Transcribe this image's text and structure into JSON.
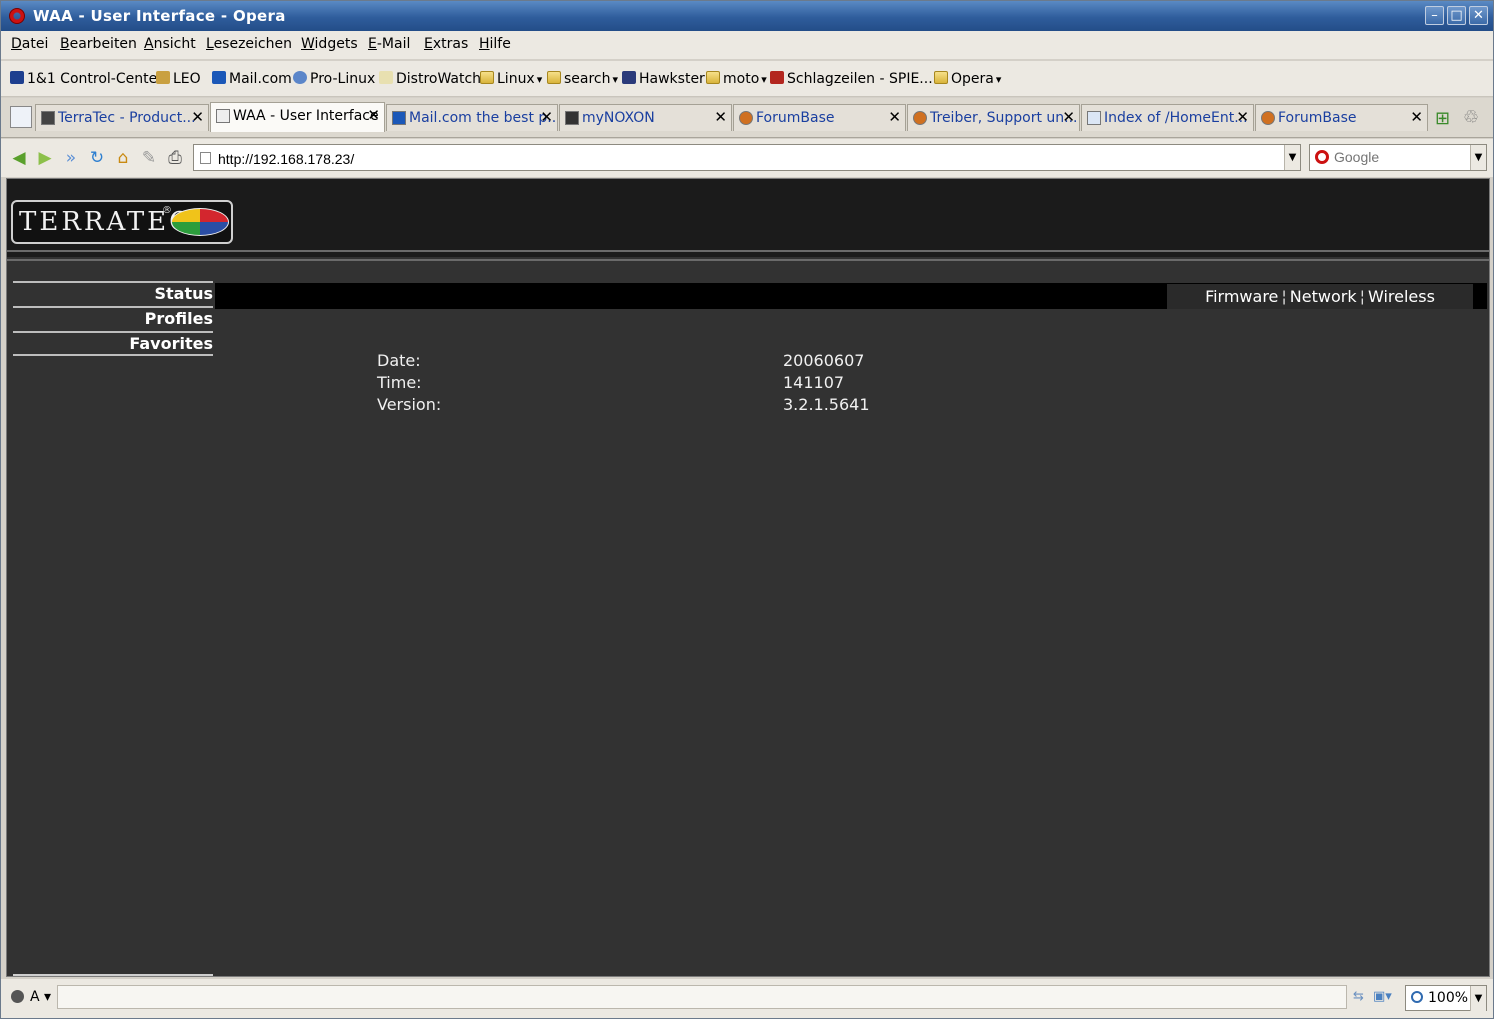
{
  "window": {
    "title": "WAA - User Interface - Opera"
  },
  "menu": [
    "Datei",
    "Bearbeiten",
    "Ansicht",
    "Lesezeichen",
    "Widgets",
    "E-Mail",
    "Extras",
    "Hilfe"
  ],
  "bookmarks": [
    "1&1 Control-Center",
    "LEO",
    "Mail.com",
    "Pro-Linux",
    "DistroWatch",
    "Linux",
    "search",
    "Hawkster",
    "moto",
    "Schlagzeilen - SPIE...",
    "Opera"
  ],
  "tabs": [
    {
      "label": "TerraTec - Product...",
      "active": false
    },
    {
      "label": "WAA - User Interface",
      "active": true
    },
    {
      "label": "Mail.com the best p...",
      "active": false
    },
    {
      "label": "myNOXON",
      "active": false
    },
    {
      "label": "ForumBase",
      "active": false
    },
    {
      "label": "Treiber, Support un...",
      "active": false
    },
    {
      "label": "Index of /HomeEnt...",
      "active": false
    },
    {
      "label": "ForumBase",
      "active": false
    }
  ],
  "address": {
    "url": "http://192.168.178.23/",
    "search_placeholder": "Google"
  },
  "page": {
    "logo_text": "TERRATEC",
    "logo_reg": "®",
    "sidenav": [
      "Status",
      "Profiles",
      "Favorites"
    ],
    "subnav": {
      "firmware": "Firmware",
      "network": "Network",
      "wireless": "Wireless",
      "separator": "¦"
    },
    "info": [
      {
        "label": "Date:",
        "value": "20060607"
      },
      {
        "label": "Time:",
        "value": "141107"
      },
      {
        "label": "Version:",
        "value": "3.2.1.5641"
      }
    ]
  },
  "status": {
    "mode": "A",
    "zoom": "100%"
  }
}
